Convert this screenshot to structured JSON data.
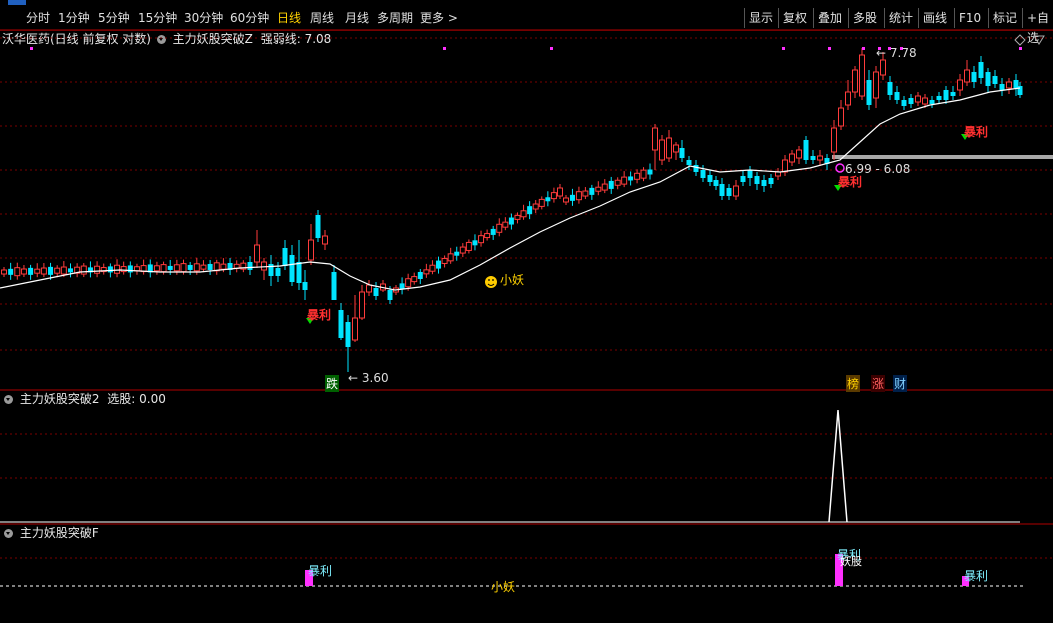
{
  "toolbar": {
    "timeframes": [
      "分时",
      "1分钟",
      "5分钟",
      "15分钟",
      "30分钟",
      "60分钟",
      "日线",
      "周线",
      "月线",
      "多周期",
      "更多 >"
    ],
    "active_index": 6,
    "right_buttons": [
      "显示",
      "复权",
      "叠加",
      "多股",
      "统计",
      "画线",
      "F10",
      "标记",
      "+自选"
    ]
  },
  "main_panel": {
    "stock_title": "沃华医药(日线 前复权 对数)",
    "indicator_name": "主力妖股突破Z",
    "indicator_value_label": "强弱线: 7.08",
    "high_label": "7.78",
    "low_label": "3.60",
    "level_label": "6.99 - 6.08",
    "signals": {
      "baoli": "暴利",
      "xiaoyao": "小妖",
      "die": "跌",
      "bang": "榜",
      "zhang": "涨",
      "cai": "财"
    }
  },
  "panel2": {
    "indicator_name": "主力妖股突破2",
    "value_label": "选股: 0.00"
  },
  "panel3": {
    "indicator_name": "主力妖股突破F",
    "labels": {
      "baoli": "暴利",
      "xiaoyao": "小妖",
      "yaogu": "妖股"
    }
  },
  "colors": {
    "up": "#ff3c3c",
    "down": "#00e5ff",
    "ma": "#ffffff",
    "magenta": "#ff30ff",
    "grid": "#7a0000",
    "active_tab": "#ffd200"
  }
}
